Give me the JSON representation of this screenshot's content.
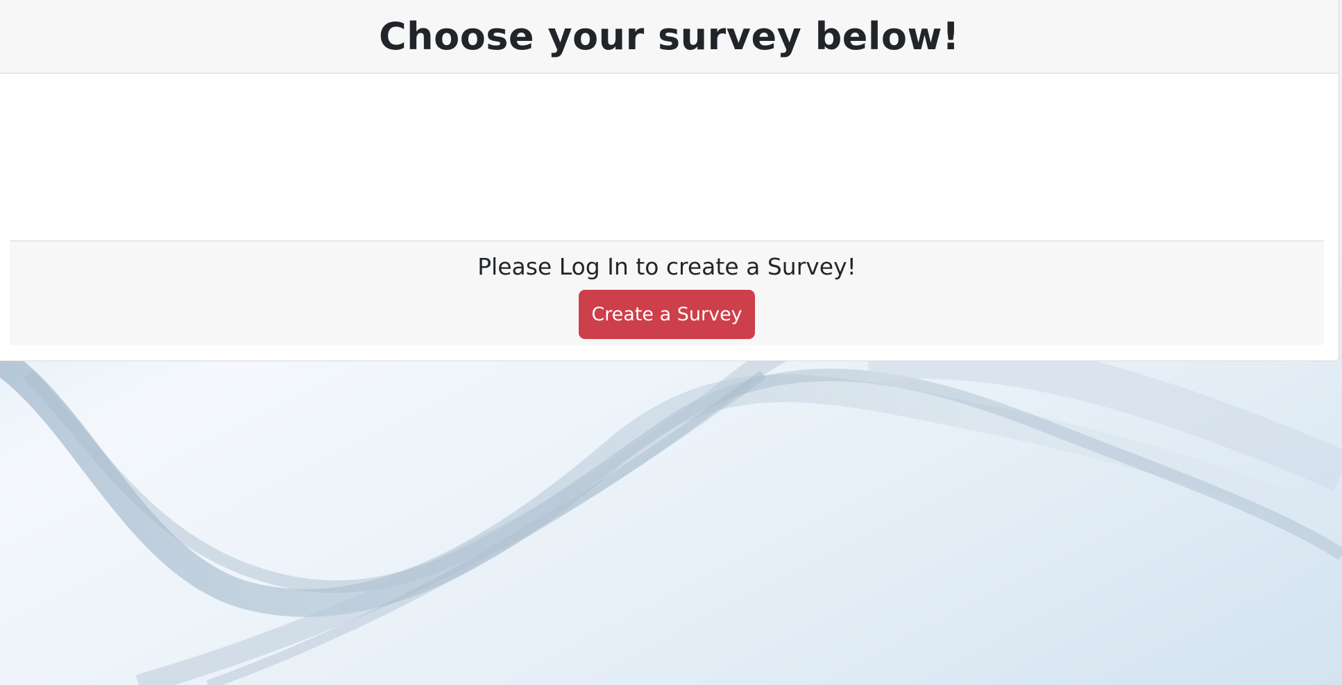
{
  "header": {
    "title": "Choose your survey below!"
  },
  "surveys": [],
  "login_panel": {
    "prompt": "Please Log In to create a Survey!",
    "create_button_label": "Create a Survey"
  },
  "colors": {
    "button": "#cd3f4a",
    "header_bg": "#f7f7f7",
    "text": "#212529"
  }
}
